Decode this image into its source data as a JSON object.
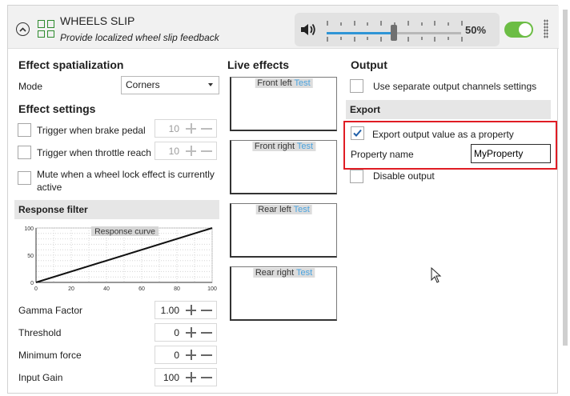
{
  "header": {
    "title": "WHEELS SLIP",
    "subtitle": "Provide localized wheel slip feedback",
    "volume_value": "50%",
    "volume_level": 0.5,
    "toggle_on": true
  },
  "left": {
    "spatialization_heading": "Effect spatialization",
    "mode_label": "Mode",
    "mode_value": "Corners",
    "settings_heading": "Effect settings",
    "brake_label": "Trigger when brake pedal",
    "brake_value": "10",
    "throttle_label": "Trigger when throttle reach",
    "throttle_value": "10",
    "mute_label": "Mute when a wheel lock effect is currently active",
    "response_filter_heading": "Response filter",
    "chart_title": "Response curve",
    "gamma_label": "Gamma Factor",
    "gamma_value": "1.00",
    "threshold_label": "Threshold",
    "threshold_value": "0",
    "min_force_label": "Minimum force",
    "min_force_value": "0",
    "input_gain_label": "Input Gain",
    "input_gain_value": "100"
  },
  "chart_data": {
    "type": "line",
    "title": "Response curve",
    "xlabel": "",
    "ylabel": "",
    "x_ticks": [
      "0",
      "20",
      "40",
      "60",
      "80",
      "100"
    ],
    "y_ticks": [
      "0",
      "50",
      "100"
    ],
    "xlim": [
      0,
      100
    ],
    "ylim": [
      0,
      100
    ],
    "grid": true,
    "series": [
      {
        "x": [
          0,
          100
        ],
        "y": [
          0,
          100
        ]
      }
    ]
  },
  "live": {
    "heading": "Live effects",
    "test_label": "Test",
    "boxes": [
      "Front left",
      "Front right",
      "Rear left",
      "Rear right"
    ]
  },
  "output": {
    "heading": "Output",
    "separate_label": "Use separate output channels settings",
    "export_heading": "Export",
    "export_label": "Export output value as a property",
    "property_name_label": "Property name",
    "property_name_value": "MyProperty",
    "disable_label": "Disable output"
  },
  "colors": {
    "accent": "#2f95d6",
    "toggle": "#6cbd45",
    "highlight": "#e01c24",
    "icon_green": "#2e8b2e"
  },
  "icons": [
    "collapse-icon",
    "grid-icon",
    "speaker-icon",
    "drag-handle-icon",
    "checkmark-icon",
    "mouse-cursor-icon"
  ]
}
